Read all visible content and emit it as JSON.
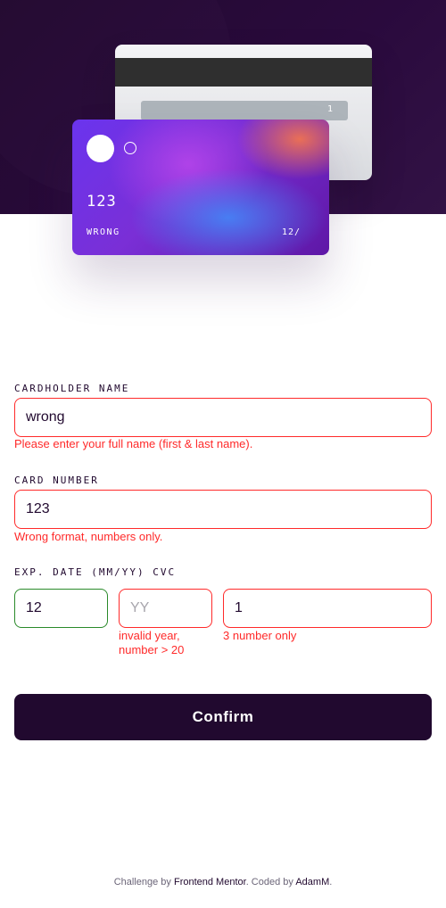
{
  "card_front": {
    "number": "123",
    "holder": "WRONG",
    "expiry": "12/"
  },
  "card_back": {
    "cvc": "1"
  },
  "form": {
    "cardholder": {
      "label": "CARDHOLDER NAME",
      "value": "wrong",
      "error": "Please enter your full name (first & last name)."
    },
    "card_number": {
      "label": "CARD NUMBER",
      "value": "123",
      "error": "Wrong format, numbers only."
    },
    "expiry_cvc": {
      "label": "EXP. DATE (MM/YY) CVC",
      "month_value": "12",
      "year_placeholder": "YY",
      "year_error_line1": "invalid year,",
      "year_error_line2": "number > 20",
      "cvc_value": "1",
      "cvc_error": "3 number only"
    },
    "confirm_label": "Confirm"
  },
  "footer": {
    "prefix": "Challenge by",
    "link1": "Frontend Mentor",
    "middle": ". Coded by",
    "link2": "AdamM",
    "suffix": "."
  },
  "colors": {
    "dark_violet": "#21092f",
    "error_red": "#ff2a2a",
    "valid_green": "#2a8a2a"
  }
}
